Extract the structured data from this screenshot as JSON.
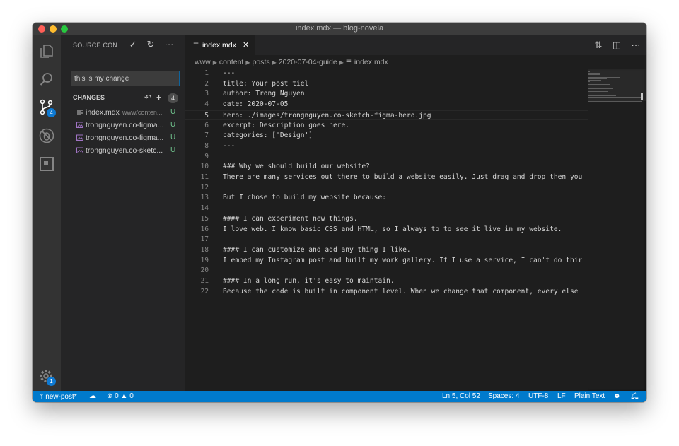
{
  "window": {
    "title": "index.mdx — blog-novela"
  },
  "activity_bar": {
    "scm_badge": "4",
    "settings_badge": "1"
  },
  "sidebar": {
    "title": "SOURCE CON...",
    "commit_message": "this is my change",
    "changes_title": "CHANGES",
    "changes_count": "4",
    "files": [
      {
        "name": "index.mdx",
        "path": "www/conten...",
        "status": "U",
        "icon": "file-lines-icon"
      },
      {
        "name": "trongnguyen.co-figma...",
        "path": "",
        "status": "U",
        "icon": "image-file-icon"
      },
      {
        "name": "trongnguyen.co-figma...",
        "path": "",
        "status": "U",
        "icon": "image-file-icon"
      },
      {
        "name": "trongnguyen.co-sketc...",
        "path": "",
        "status": "U",
        "icon": "image-file-icon"
      }
    ]
  },
  "editor": {
    "tab": {
      "label": "index.mdx"
    },
    "breadcrumb": [
      "www",
      "content",
      "posts",
      "2020-07-04-guide",
      "index.mdx"
    ],
    "active_line": 5,
    "lines": [
      "---",
      "title: Your post tiel",
      "author: Trong Nguyen",
      "date: 2020-07-05",
      "hero: ./images/trongnguyen.co-sketch-figma-hero.jpg",
      "excerpt: Description goes here.",
      "categories: ['Design']",
      "---",
      "",
      "### Why we should build our website?",
      "There are many services out there to build a website easily. Just drag and drop then you",
      "",
      "But I chose to build my website because:",
      "",
      "#### I can experiment new things.",
      "I love web. I know basic CSS and HTML, so I always to to see it live in my website.",
      "",
      "#### I can customize and add any thing I like.",
      "I embed my Instagram post and built my work gallery. If I use a service, I can't do thir",
      "",
      "#### In a long run, it's easy to maintain.",
      "Because the code is built in component level. When we change that component, every else"
    ]
  },
  "status_bar": {
    "branch": "new-post*",
    "errors": "0",
    "warnings": "0",
    "position": "Ln 5, Col 52",
    "spaces": "Spaces: 4",
    "encoding": "UTF-8",
    "eol": "LF",
    "language": "Plain Text"
  },
  "colors": {
    "status_bar": "#007acc",
    "badge": "#0e7ad3",
    "untracked": "#73c991"
  }
}
